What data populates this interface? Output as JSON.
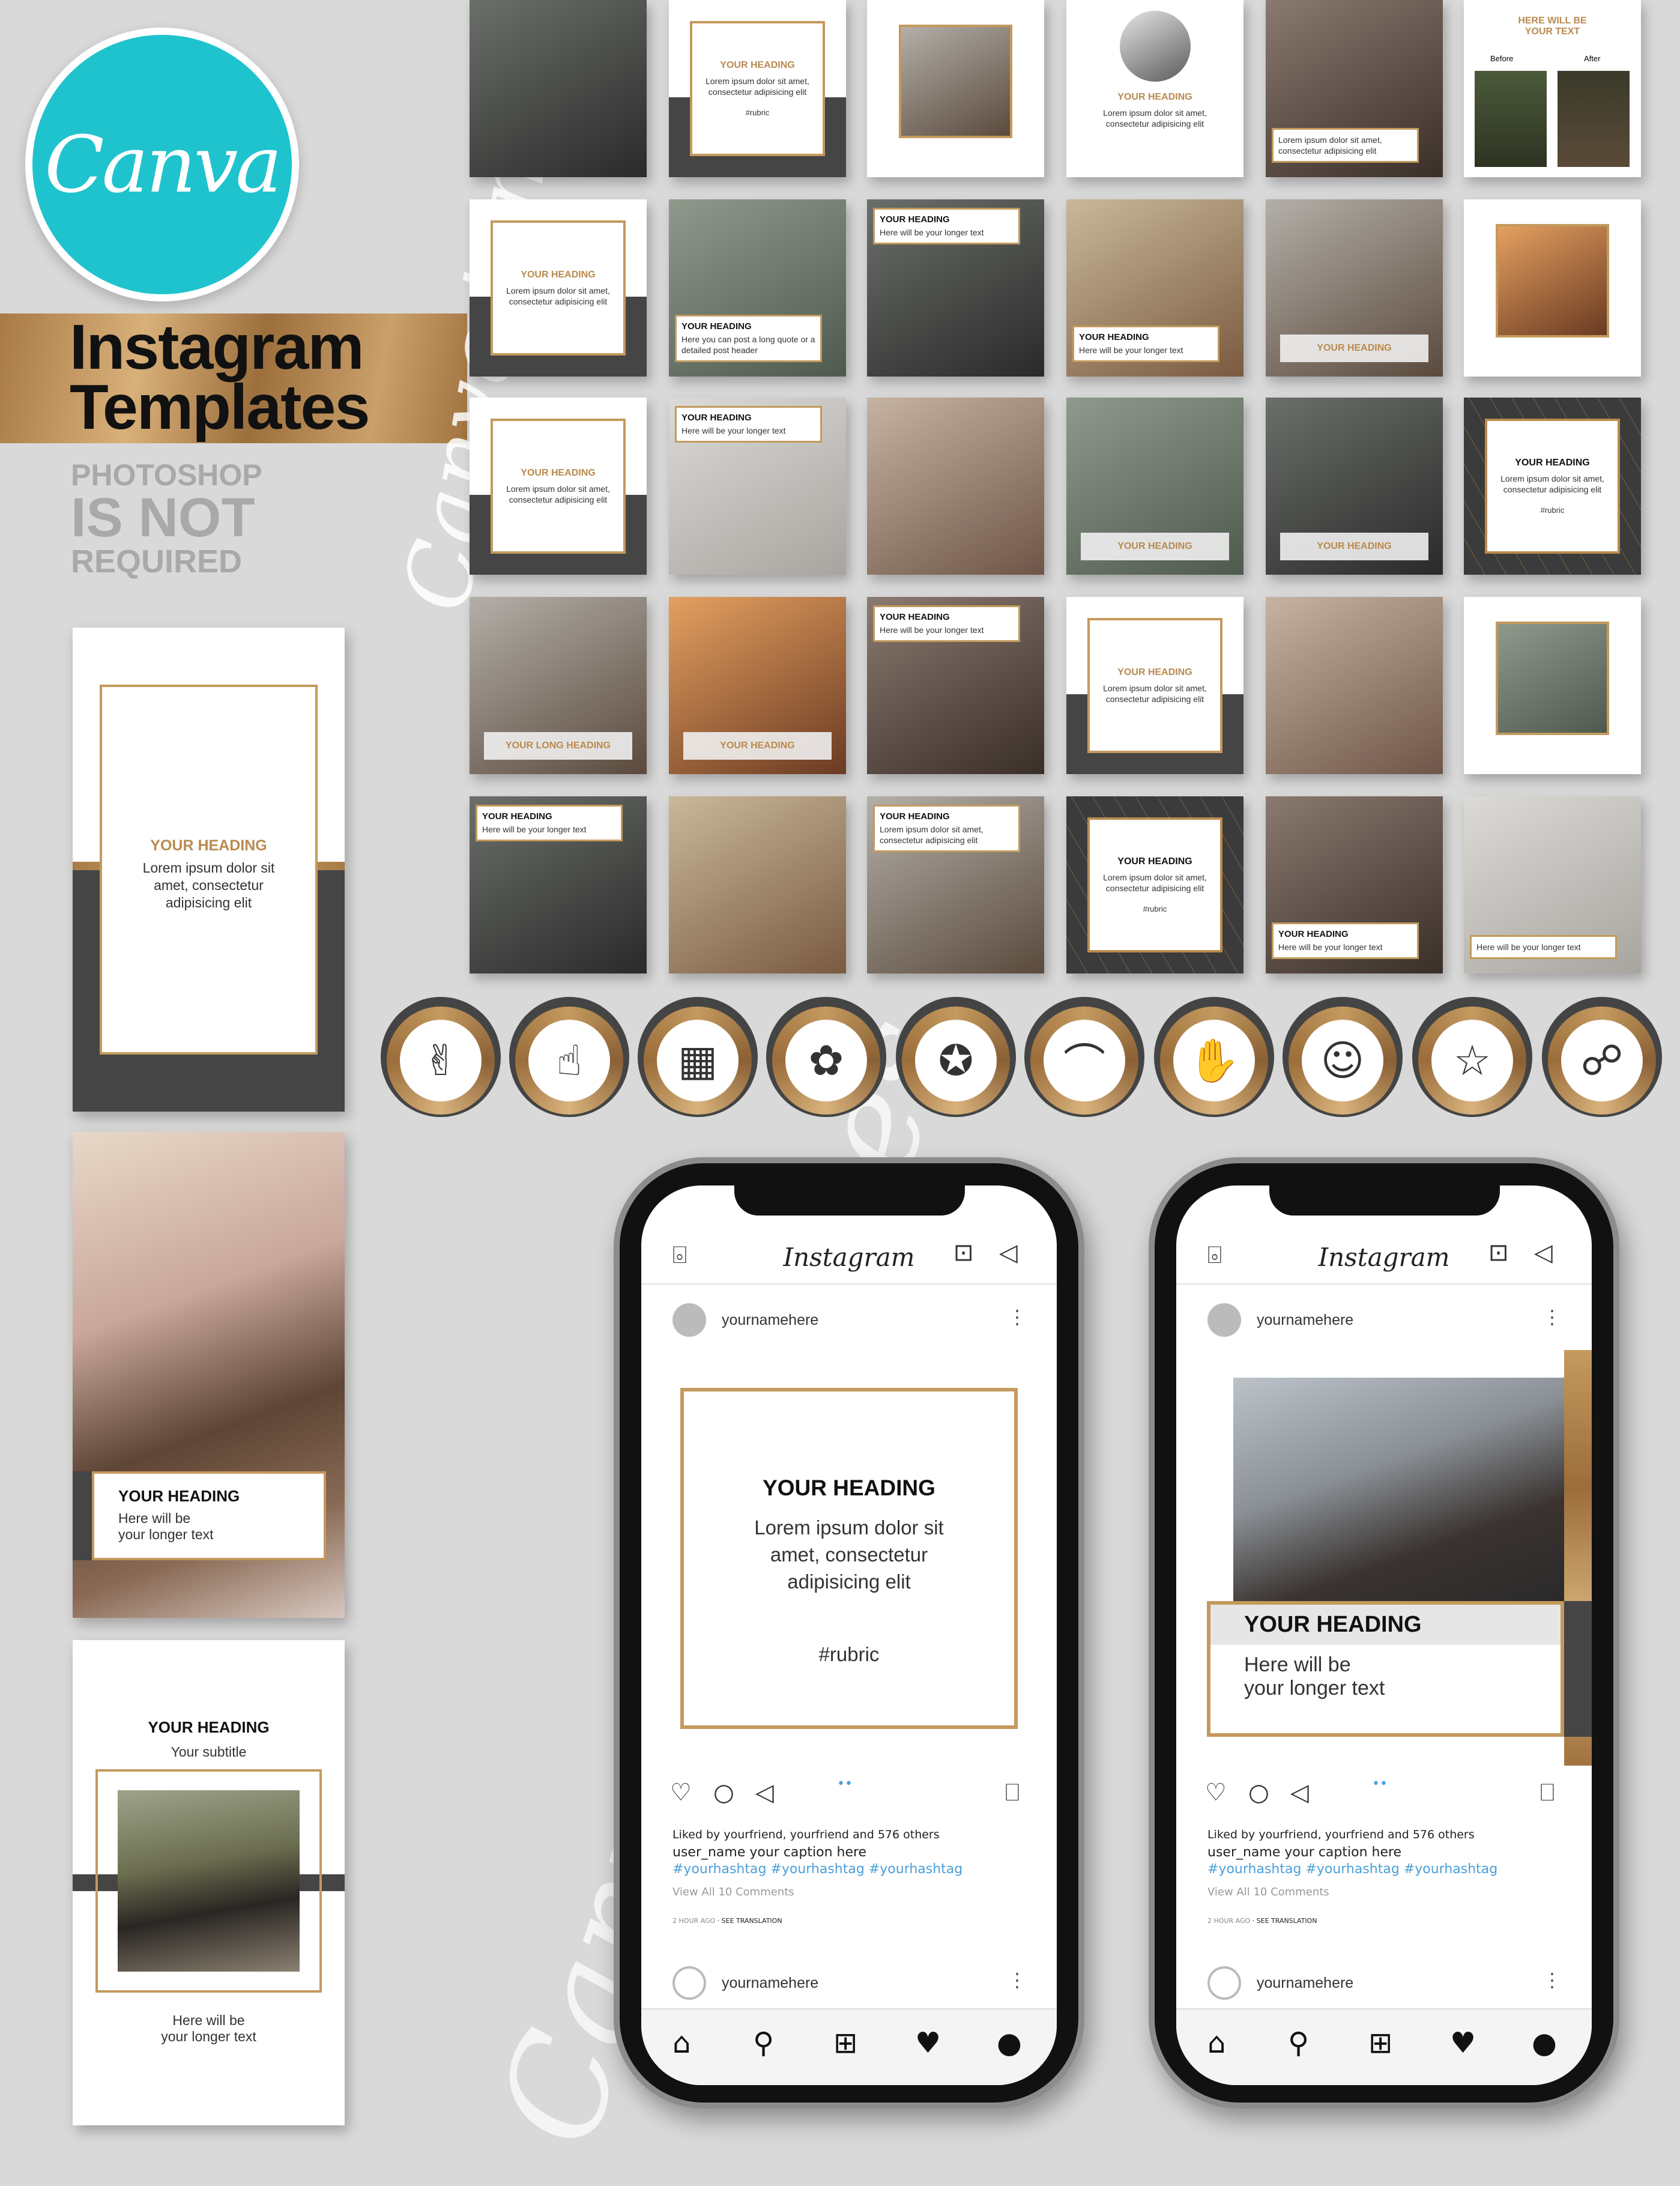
{
  "brand": {
    "logo_text": "Canva",
    "title_line1": "Instagram",
    "title_line2": "Templates",
    "sub_line1": "PHOTOSHOP",
    "sub_line2": "IS NOT",
    "sub_line3": "REQUIRED",
    "watermark": "Canva templates"
  },
  "colors": {
    "gold": "#b98a4e",
    "teal": "#1fc3cd",
    "dark": "#454545",
    "background": "#d9d9d9",
    "hashtag": "#4a9fd8"
  },
  "grid": [
    {
      "kind": "photo"
    },
    {
      "kind": "card",
      "heading": "YOUR HEADING",
      "body": "Lorem ipsum dolor sit amet, consectetur adipisicing elit",
      "rubric": "#rubric"
    },
    {
      "kind": "framed"
    },
    {
      "kind": "circle",
      "heading": "YOUR HEADING",
      "body": "Lorem ipsum dolor sit amet, consectetur adipisicing elit"
    },
    {
      "kind": "photo-caption",
      "body": "Lorem ipsum dolor sit amet, consectetur adipisicing elit"
    },
    {
      "kind": "before-after",
      "heading": "HERE WILL BE YOUR TEXT",
      "before": "Before",
      "after": "After"
    },
    {
      "kind": "card",
      "heading": "YOUR HEADING",
      "body": "Lorem ipsum dolor sit amet, consectetur adipisicing elit"
    },
    {
      "kind": "photo-caption",
      "heading": "YOUR HEADING",
      "body": "Here you can post a long quote or a detailed post header"
    },
    {
      "kind": "photo-caption",
      "heading": "YOUR HEADING",
      "body": "Here will be your longer text"
    },
    {
      "kind": "photo-caption",
      "heading": "YOUR HEADING",
      "body": "Here will be your longer text"
    },
    {
      "kind": "photo-label",
      "heading": "YOUR HEADING"
    },
    {
      "kind": "framed"
    },
    {
      "kind": "card",
      "heading": "YOUR HEADING",
      "body": "Lorem ipsum dolor sit amet, consectetur adipisicing elit"
    },
    {
      "kind": "photo-caption",
      "heading": "YOUR HEADING",
      "body": "Here will be your longer text"
    },
    {
      "kind": "photo"
    },
    {
      "kind": "photo-label",
      "heading": "YOUR HEADING"
    },
    {
      "kind": "photo-label",
      "heading": "YOUR HEADING"
    },
    {
      "kind": "dark-card",
      "heading": "YOUR HEADING",
      "body": "Lorem ipsum dolor sit amet, consectetur adipisicing elit",
      "rubric": "#rubric"
    },
    {
      "kind": "photo-label",
      "heading": "YOUR LONG HEADING"
    },
    {
      "kind": "photo-label",
      "heading": "YOUR HEADING"
    },
    {
      "kind": "photo-caption",
      "heading": "YOUR HEADING",
      "body": "Here will be your longer text"
    },
    {
      "kind": "card",
      "heading": "YOUR HEADING",
      "body": "Lorem ipsum dolor sit amet, consectetur adipisicing elit"
    },
    {
      "kind": "photo"
    },
    {
      "kind": "framed"
    },
    {
      "kind": "photo-caption",
      "heading": "YOUR HEADING",
      "body": "Here will be your longer text"
    },
    {
      "kind": "photo"
    },
    {
      "kind": "photo-caption",
      "heading": "YOUR HEADING",
      "body": "Lorem ipsum dolor sit amet, consectetur adipisicing elit"
    },
    {
      "kind": "dark-card",
      "heading": "YOUR HEADING",
      "body": "Lorem ipsum dolor sit amet, consectetur adipisicing elit",
      "rubric": "#rubric"
    },
    {
      "kind": "photo-caption",
      "heading": "YOUR HEADING",
      "body": "Here will be your longer text"
    },
    {
      "kind": "photo-caption",
      "body": "Here will be your longer text"
    }
  ],
  "highlights": [
    {
      "icon": "handshake-icon",
      "glyph": "✌"
    },
    {
      "icon": "rock-hand-icon",
      "glyph": "☝"
    },
    {
      "icon": "buildings-icon",
      "glyph": "▦"
    },
    {
      "icon": "beauty-icon",
      "glyph": "✿"
    },
    {
      "icon": "badge-star-icon",
      "glyph": "✪"
    },
    {
      "icon": "high-heel-icon",
      "glyph": "⌒"
    },
    {
      "icon": "hands-together-icon",
      "glyph": "✋"
    },
    {
      "icon": "profile-card-icon",
      "glyph": "☺"
    },
    {
      "icon": "rating-hand-icon",
      "glyph": "☆"
    },
    {
      "icon": "network-icon",
      "glyph": "☍"
    }
  ],
  "stories": [
    {
      "heading": "YOUR HEADING",
      "body": "Lorem ipsum dolor sit amet, consectetur adipisicing elit"
    },
    {
      "heading": "YOUR HEADING",
      "body_line1": "Here will be",
      "body_line2": "your longer text"
    },
    {
      "heading": "YOUR HEADING",
      "subtitle": "Your subtitle",
      "body_line1": "Here will be",
      "body_line2": "your longer text"
    }
  ],
  "phones": [
    {
      "app_title": "Instagram",
      "username": "yournamehere",
      "post": {
        "heading": "YOUR HEADING",
        "line1": "Lorem ipsum dolor sit",
        "line2": "amet, consectetur",
        "line3": "adipisicing elit",
        "rubric": "#rubric"
      },
      "liked": "Liked by yourfriend, yourfriend and 576 others",
      "caption": "user_name  your caption here",
      "hashtags": "#yourhashtag #yourhashtag #yourhashtag",
      "comments": "View All 10 Comments",
      "time": "2 HOUR AGO",
      "translate": "· SEE TRANSLATION",
      "next_username": "yournamehere"
    },
    {
      "app_title": "Instagram",
      "username": "yournamehere",
      "post": {
        "heading": "YOUR HEADING",
        "line1": "Here will be",
        "line2": "your longer text"
      },
      "liked": "Liked by yourfriend, yourfriend and 576 others",
      "caption": "user_name  your caption here",
      "hashtags": "#yourhashtag #yourhashtag #yourhashtag",
      "comments": "View All 10 Comments",
      "time": "2 HOUR AGO",
      "translate": "· SEE TRANSLATION",
      "next_username": "yournamehere"
    }
  ]
}
